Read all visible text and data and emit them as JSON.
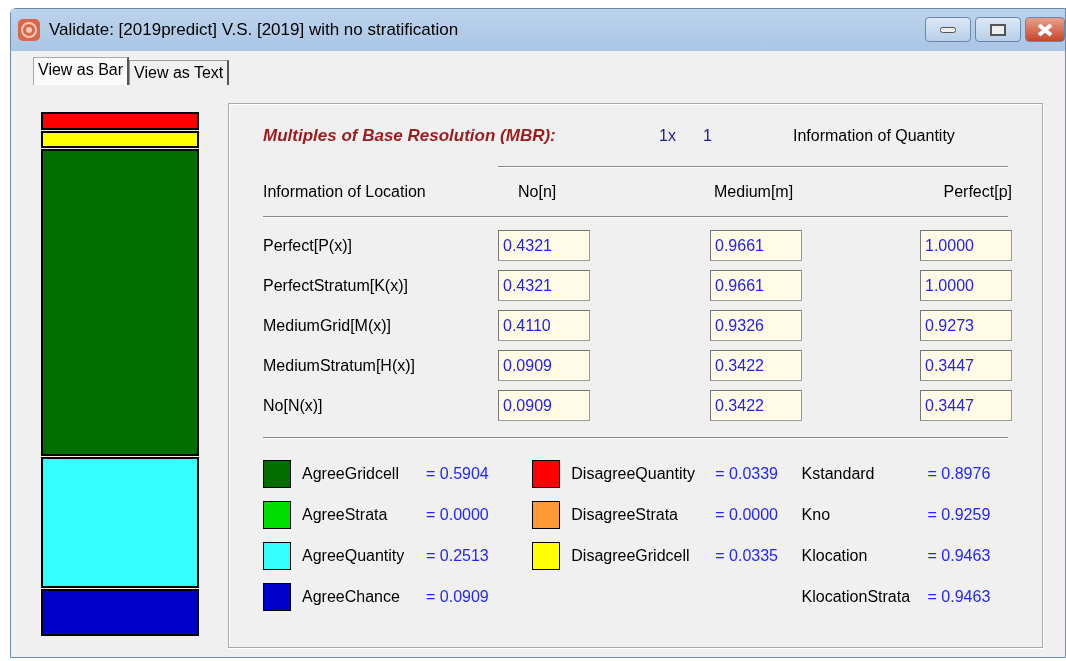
{
  "window": {
    "title": "Validate: [2019predict]  V.S.  [2019] with no stratification"
  },
  "tabs": [
    {
      "label": "View as Bar",
      "selected": true
    },
    {
      "label": "View as Text",
      "selected": false
    }
  ],
  "mbr": {
    "title": "Multiples of Base Resolution (MBR):",
    "multiplier": "1x",
    "value": "1"
  },
  "quantity_header": "Information of Quantity",
  "location_header": "Information of Location",
  "columns": [
    "No[n]",
    "Medium[m]",
    "Perfect[p]"
  ],
  "rows": [
    {
      "label": "Perfect[P(x)]",
      "values": [
        "0.4321",
        "0.9661",
        "1.0000"
      ]
    },
    {
      "label": "PerfectStratum[K(x)]",
      "values": [
        "0.4321",
        "0.9661",
        "1.0000"
      ]
    },
    {
      "label": "MediumGrid[M(x)]",
      "values": [
        "0.4110",
        "0.9326",
        "0.9273"
      ]
    },
    {
      "label": "MediumStratum[H(x)]",
      "values": [
        "0.0909",
        "0.3422",
        "0.3447"
      ]
    },
    {
      "label": "No[N(x)]",
      "values": [
        "0.0909",
        "0.3422",
        "0.3447"
      ]
    }
  ],
  "legend": [
    {
      "label": "AgreeGridcell",
      "value": "= 0.5904",
      "color": "#006f00"
    },
    {
      "label": "AgreeStrata",
      "value": "= 0.0000",
      "color": "#00dd00"
    },
    {
      "label": "AgreeQuantity",
      "value": "= 0.2513",
      "color": "#33ffff"
    },
    {
      "label": "AgreeChance",
      "value": "= 0.0909",
      "color": "#0000cc"
    },
    {
      "label": "DisagreeQuantity",
      "value": "= 0.0339",
      "color": "#ff0000"
    },
    {
      "label": "DisagreeStrata",
      "value": "= 0.0000",
      "color": "#ff9933"
    },
    {
      "label": "DisagreeGridcell",
      "value": "= 0.0335",
      "color": "#ffff00"
    }
  ],
  "kappas": [
    {
      "label": "Kstandard",
      "value": "= 0.8976"
    },
    {
      "label": "Kno",
      "value": "= 0.9259"
    },
    {
      "label": "Klocation",
      "value": "= 0.9463"
    },
    {
      "label": "KlocationStrata",
      "value": "= 0.9463"
    }
  ]
}
